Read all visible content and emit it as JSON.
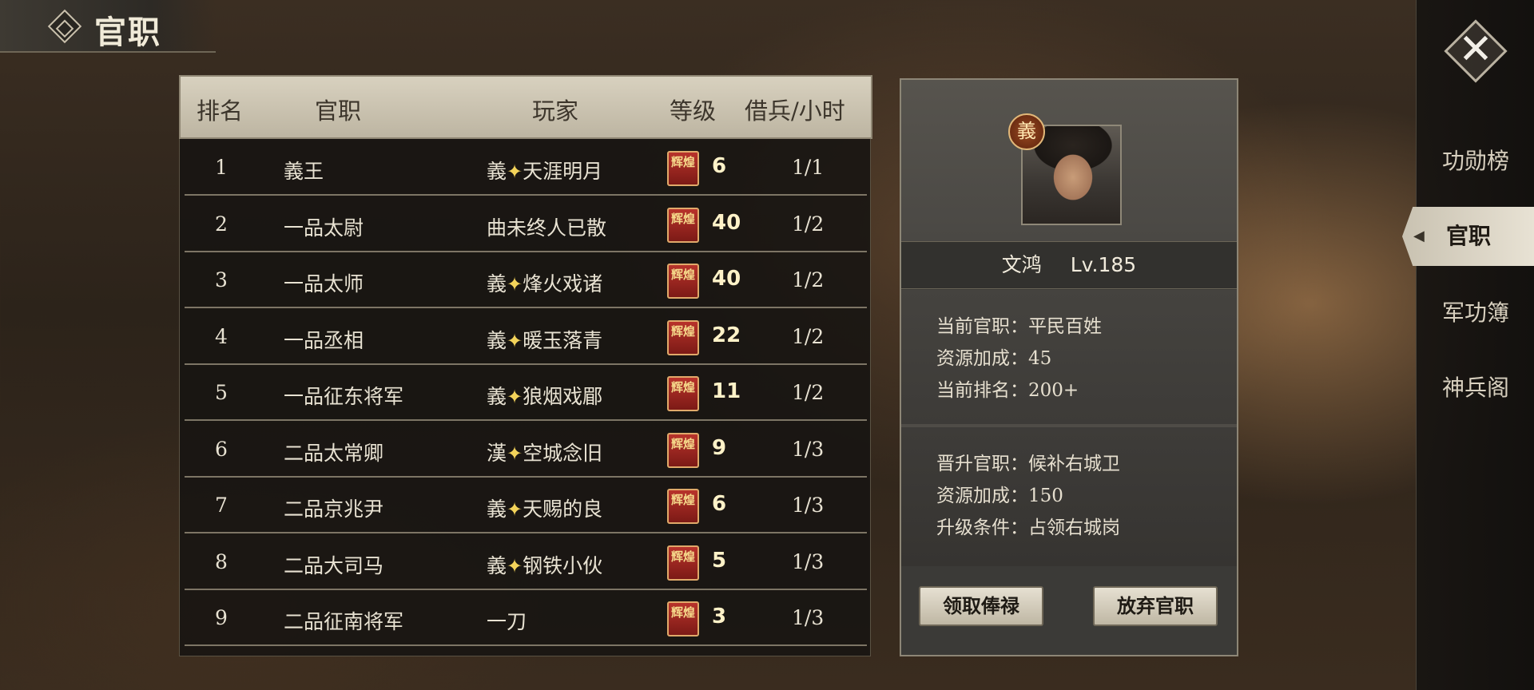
{
  "header": {
    "title": "官职"
  },
  "table": {
    "columns": [
      "排名",
      "官职",
      "玩家",
      "等级",
      "借兵/小时"
    ],
    "rows": [
      {
        "rank": "1",
        "office": "義王",
        "faction": "義",
        "sparkle": true,
        "player": "天涯明月",
        "badge": "辉煌",
        "level": "6",
        "borrow": "1/1"
      },
      {
        "rank": "2",
        "office": "一品太尉",
        "faction": "",
        "sparkle": false,
        "player": "曲未终人已散",
        "badge": "辉煌",
        "level": "40",
        "borrow": "1/2"
      },
      {
        "rank": "3",
        "office": "一品太师",
        "faction": "義",
        "sparkle": true,
        "player": "烽火戏诸",
        "badge": "辉煌",
        "level": "40",
        "borrow": "1/2"
      },
      {
        "rank": "4",
        "office": "一品丞相",
        "faction": "義",
        "sparkle": true,
        "player": "暖玉落青",
        "badge": "辉煌",
        "level": "22",
        "borrow": "1/2"
      },
      {
        "rank": "5",
        "office": "一品征东将军",
        "faction": "義",
        "sparkle": true,
        "player": "狼烟戏郿",
        "badge": "辉煌",
        "level": "11",
        "borrow": "1/2"
      },
      {
        "rank": "6",
        "office": "二品太常卿",
        "faction": "漢",
        "sparkle": true,
        "player": "空城念旧",
        "badge": "辉煌",
        "level": "9",
        "borrow": "1/3"
      },
      {
        "rank": "7",
        "office": "二品京兆尹",
        "faction": "義",
        "sparkle": true,
        "player": "天赐的良",
        "badge": "辉煌",
        "level": "6",
        "borrow": "1/3"
      },
      {
        "rank": "8",
        "office": "二品大司马",
        "faction": "義",
        "sparkle": true,
        "player": "钢铁小伙",
        "badge": "辉煌",
        "level": "5",
        "borrow": "1/3"
      },
      {
        "rank": "9",
        "office": "二品征南将军",
        "faction": "",
        "sparkle": false,
        "player": "一刀",
        "badge": "辉煌",
        "level": "3",
        "borrow": "1/3"
      }
    ]
  },
  "detail": {
    "faction_badge": "義",
    "name": "文鸿",
    "level": "Lv.185",
    "current_office": "当前官职：平民百姓",
    "current_bonus": "资源加成：45",
    "current_rank": "当前排名：200+",
    "next_office": "晋升官职：候补右城卫",
    "next_bonus": "资源加成：150",
    "upgrade_condition": "升级条件：占领右城岗",
    "btn_salary": "领取俸禄",
    "btn_abandon": "放弃官职"
  },
  "sidebar": {
    "close_icon": "close-icon",
    "items": [
      "功勋榜",
      "官职",
      "军功簿",
      "神兵阁"
    ],
    "active_index": 1
  },
  "colors": {
    "badge_red": "#9e2a22",
    "badge_gold": "#e0a96a",
    "sparkle_gold": "#f3d35a",
    "header_bg": "#cfc8b6",
    "active_tab_bg": "#e8e2d4"
  }
}
